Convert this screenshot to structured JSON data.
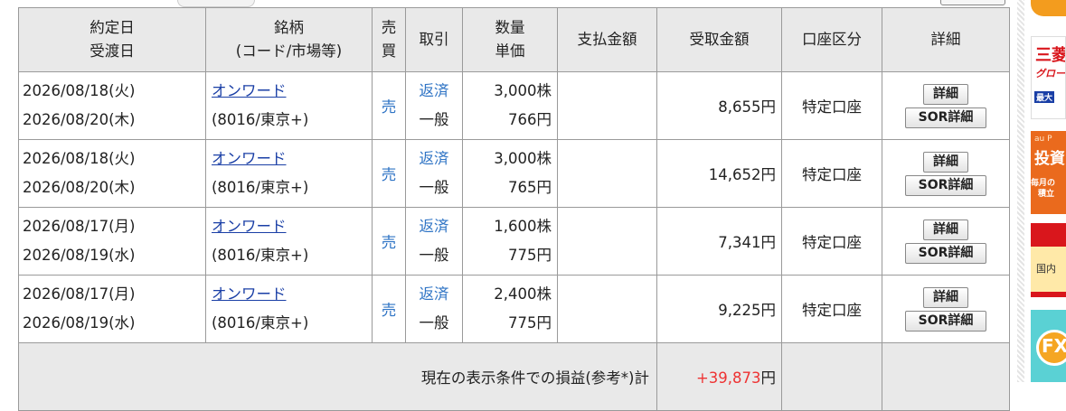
{
  "headers": {
    "trade_date": "約定日",
    "settle_date": "受渡日",
    "name": "銘柄",
    "code_market": "(コード/市場等)",
    "side_1": "売",
    "side_2": "買",
    "trade": "取引",
    "qty": "数量",
    "price": "単価",
    "pay": "支払金額",
    "receive": "受取金額",
    "account": "口座区分",
    "detail": "詳細"
  },
  "rows": [
    {
      "trade_date": "2026/08/18(火)",
      "settle_date": "2026/08/20(木)",
      "name": "オンワード",
      "code": "(8016/東京+)",
      "side": "売",
      "trade_type": "返済",
      "trade_kind": "一般",
      "qty": "3,000株",
      "price": "766円",
      "pay": "",
      "receive": "8,655円",
      "account": "特定口座",
      "detail_btn": "詳細",
      "sor_btn": "SOR詳細"
    },
    {
      "trade_date": "2026/08/18(火)",
      "settle_date": "2026/08/20(木)",
      "name": "オンワード",
      "code": "(8016/東京+)",
      "side": "売",
      "trade_type": "返済",
      "trade_kind": "一般",
      "qty": "3,000株",
      "price": "765円",
      "pay": "",
      "receive": "14,652円",
      "account": "特定口座",
      "detail_btn": "詳細",
      "sor_btn": "SOR詳細"
    },
    {
      "trade_date": "2026/08/17(月)",
      "settle_date": "2026/08/19(水)",
      "name": "オンワード",
      "code": "(8016/東京+)",
      "side": "売",
      "trade_type": "返済",
      "trade_kind": "一般",
      "qty": "1,600株",
      "price": "775円",
      "pay": "",
      "receive": "7,341円",
      "account": "特定口座",
      "detail_btn": "詳細",
      "sor_btn": "SOR詳細"
    },
    {
      "trade_date": "2026/08/17(月)",
      "settle_date": "2026/08/19(水)",
      "name": "オンワード",
      "code": "(8016/東京+)",
      "side": "売",
      "trade_type": "返済",
      "trade_kind": "一般",
      "qty": "2,400株",
      "price": "775円",
      "pay": "",
      "receive": "9,225円",
      "account": "特定口座",
      "detail_btn": "詳細",
      "sor_btn": "SOR詳細"
    }
  ],
  "total": {
    "label": "現在の表示条件での損益(参考*)計",
    "value_num": "+39,873",
    "value_unit": "円"
  },
  "ads": {
    "ad2_line1": "三菱",
    "ad2_line2": "グロー",
    "ad2_badge": "最大",
    "ad3_line1": "au P",
    "ad3_line2": "投資",
    "ad3_line3": "毎月の",
    "ad3_line4": "積立",
    "ad4_text": "国内",
    "ad5_text": "FX"
  },
  "colors": {
    "header_bg": "#e9e9e9",
    "link": "#1a3fa6",
    "side_blue": "#2f74c5",
    "profit_red": "#e33333",
    "ad_orange": "#f39c1e",
    "ad_red": "#d9161c",
    "ad_teal": "#5ad1d4"
  }
}
